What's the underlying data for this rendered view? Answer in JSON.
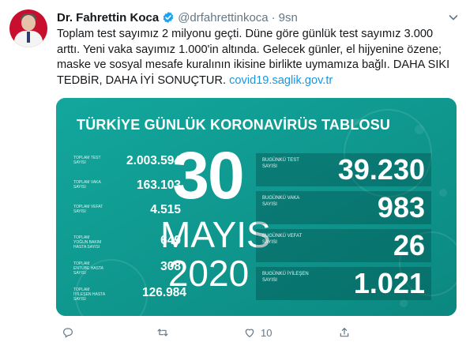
{
  "tweet": {
    "author_name": "Dr. Fahrettin Koca",
    "handle": "@drfahrettinkoca",
    "separator": "·",
    "time": "9sn",
    "text_lines": [
      "Toplam test sayımız 2 milyonu geçti. Düne göre günlük test sayımız 3.000",
      "arttı. Yeni vaka sayımız 1.000'in altında. Gelecek günler, el hijyenine özene;",
      "maske ve sosyal mesafe kuralının ikisine birlikte uymamıza bağlı. DAHA SIKI"
    ],
    "text_last": "TEDBİR, DAHA İYİ SONUÇTUR. ",
    "link_text": "covid19.saglik.gov.tr"
  },
  "card": {
    "title": "TÜRKİYE GÜNLÜK KORONAVİRÜS TABLOSU",
    "day": "30",
    "month": "MAYIS",
    "year": "2020",
    "totals": [
      {
        "label": "TOPLAM TEST SAYISI",
        "value": "2.003.594"
      },
      {
        "label": "TOPLAM VAKA SAYISI",
        "value": "163.103"
      },
      {
        "label": "TOPLAM VEFAT SAYISI",
        "value": "4.515"
      },
      {
        "label": "TOPLAM YOĞUN BAKIM HASTA SAYISI",
        "value": "649"
      },
      {
        "label": "TOPLAM ENTÜBE HASTA SAYISI",
        "value": "308"
      },
      {
        "label": "TOPLAM İYİLEŞEN HASTA SAYISI",
        "value": "126.984"
      }
    ],
    "daily": [
      {
        "label": "BUGÜNKÜ TEST SAYISI",
        "value": "39.230"
      },
      {
        "label": "BUGÜNKÜ VAKA SAYISI",
        "value": "983"
      },
      {
        "label": "BUGÜNKÜ VEFAT SAYISI",
        "value": "26"
      },
      {
        "label": "BUGÜNKÜ İYİLEŞEN SAYISI",
        "value": "1.021"
      }
    ]
  },
  "actions": {
    "reply_icon": "reply-icon",
    "retweet_icon": "retweet-icon",
    "like_icon": "heart-icon",
    "like_count": "10",
    "share_icon": "share-icon"
  },
  "colors": {
    "card_bg": "#0f9b92",
    "link": "#1b95e0",
    "verified": "#1da1f2",
    "muted": "#657786"
  }
}
